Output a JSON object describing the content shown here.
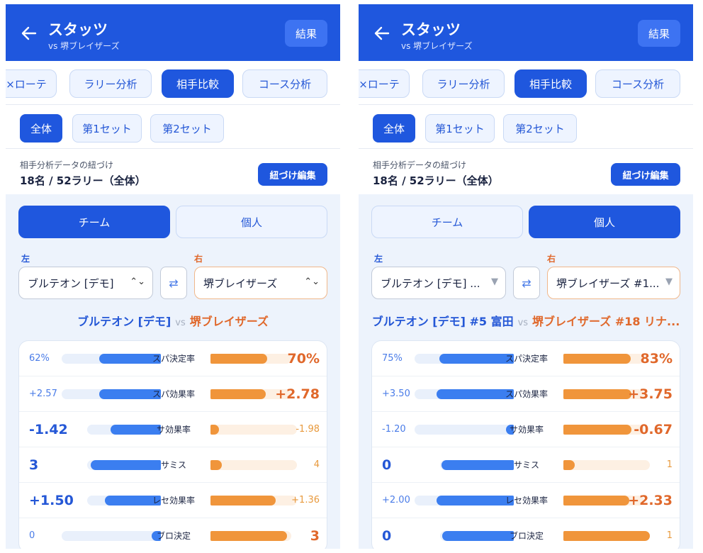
{
  "colors": {
    "primary": "#1f57de",
    "left_team": "#3b7ef0",
    "right_team": "#f0953b",
    "right_text": "#e0682b"
  },
  "panels": [
    {
      "header": {
        "title": "スタッツ",
        "subtitle": "vs 堺ブレイザーズ",
        "result_button": "結果",
        "back_icon": "arrow-left-icon"
      },
      "tabs": [
        {
          "label": "×ローテ",
          "active": false
        },
        {
          "label": "ラリー分析",
          "active": false
        },
        {
          "label": "相手比較",
          "active": true
        },
        {
          "label": "コース分析",
          "active": false
        }
      ],
      "sets": [
        {
          "label": "全体",
          "active": true
        },
        {
          "label": "第1セット",
          "active": false
        },
        {
          "label": "第2セット",
          "active": false
        }
      ],
      "link": {
        "label": "相手分析データの紐づけ",
        "value": "18名 / 52ラリー（全体）",
        "button": "紐づけ編集"
      },
      "mode": {
        "team": "チーム",
        "individual": "個人",
        "active": "team"
      },
      "left_side_label": "左",
      "right_side_label": "右",
      "left_select": "ブルテオン [デモ]",
      "right_select": "堺ブレイザーズ",
      "caret": "⌃⌄",
      "swap_icon": "⇄",
      "vs": {
        "left": "ブルテオン [デモ]",
        "middle": "vs",
        "right": "堺ブレイザーズ"
      },
      "stats": [
        {
          "label": "スパ決定率",
          "left": "62%",
          "right": "70%",
          "left_ratio": 0.62,
          "right_ratio": 0.7,
          "winner": "right"
        },
        {
          "label": "スパ効果率",
          "left": "+2.57",
          "right": "+2.78",
          "left_ratio": 0.62,
          "right_ratio": 0.68,
          "winner": "right"
        },
        {
          "label": "サ効果率",
          "left": "-1.42",
          "right": "-1.98",
          "left_ratio": 0.68,
          "right_ratio": 0.1,
          "winner": "left"
        },
        {
          "label": "サミス",
          "left": "3",
          "right": "4",
          "left_ratio": 0.95,
          "right_ratio": 0.13,
          "winner": "left"
        },
        {
          "label": "レセ効果率",
          "left": "+1.50",
          "right": "+1.36",
          "left_ratio": 0.76,
          "right_ratio": 0.75,
          "winner": "left"
        },
        {
          "label": "ブロ決定",
          "left": "0",
          "right": "3",
          "left_ratio": 0.09,
          "right_ratio": 0.95,
          "winner": "right"
        }
      ]
    },
    {
      "header": {
        "title": "スタッツ",
        "subtitle": "vs 堺ブレイザーズ",
        "result_button": "結果",
        "back_icon": "arrow-left-icon"
      },
      "tabs": [
        {
          "label": "×ローテ",
          "active": false
        },
        {
          "label": "ラリー分析",
          "active": false
        },
        {
          "label": "相手比較",
          "active": true
        },
        {
          "label": "コース分析",
          "active": false
        }
      ],
      "sets": [
        {
          "label": "全体",
          "active": true
        },
        {
          "label": "第1セット",
          "active": false
        },
        {
          "label": "第2セット",
          "active": false
        }
      ],
      "link": {
        "label": "相手分析データの紐づけ",
        "value": "18名 / 52ラリー（全体）",
        "button": "紐づけ編集"
      },
      "mode": {
        "team": "チーム",
        "individual": "個人",
        "active": "individual"
      },
      "left_side_label": "左",
      "right_side_label": "右",
      "left_select": "ブルテオン [デモ] ...",
      "right_select": "堺ブレイザーズ #1...",
      "caret": "▼",
      "swap_icon": "⇄",
      "vs": {
        "left": "ブルテオン [デモ] #5 富田",
        "middle": "vs",
        "right": "堺ブレイザーズ #18 リナ..."
      },
      "stats": [
        {
          "label": "スパ決定率",
          "left": "75%",
          "right": "83%",
          "left_ratio": 0.75,
          "right_ratio": 0.83,
          "winner": "right"
        },
        {
          "label": "スパ効果率",
          "left": "+3.50",
          "right": "+3.75",
          "left_ratio": 0.78,
          "right_ratio": 0.84,
          "winner": "right"
        },
        {
          "label": "サ効果率",
          "left": "-1.20",
          "right": "-0.67",
          "left_ratio": 0.08,
          "right_ratio": 0.84,
          "winner": "right"
        },
        {
          "label": "サミス",
          "left": "0",
          "right": "1",
          "left_ratio": 0.98,
          "right_ratio": 0.13,
          "winner": "left"
        },
        {
          "label": "レセ効果率",
          "left": "+2.00",
          "right": "+2.33",
          "left_ratio": 0.78,
          "right_ratio": 0.82,
          "winner": "right"
        },
        {
          "label": "ブロ決定",
          "left": "0",
          "right": "1",
          "left_ratio": 0.97,
          "right_ratio": 1.0,
          "winner": "left"
        }
      ]
    }
  ]
}
